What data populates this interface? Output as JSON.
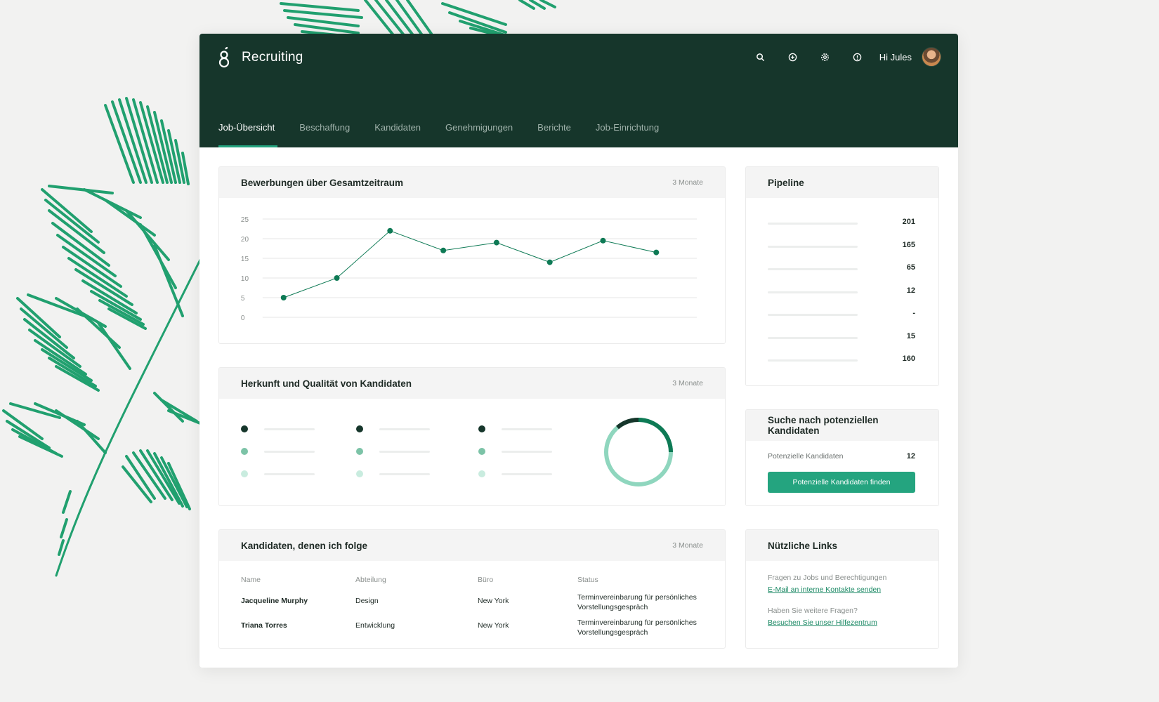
{
  "app": {
    "title": "Recruiting",
    "greeting": "Hi Jules"
  },
  "icons": {
    "search": "search-icon",
    "add": "plus-circle-icon",
    "settings": "gear-icon",
    "help": "help-icon"
  },
  "tabs": [
    {
      "label": "Job-Übersicht",
      "active": true
    },
    {
      "label": "Beschaffung",
      "active": false
    },
    {
      "label": "Kandidaten",
      "active": false
    },
    {
      "label": "Genehmigungen",
      "active": false
    },
    {
      "label": "Berichte",
      "active": false
    },
    {
      "label": "Job-Einrichtung",
      "active": false
    }
  ],
  "applications": {
    "title": "Bewerbungen über Gesamtzeitraum",
    "period": "3 Monate"
  },
  "chart_data": {
    "type": "line",
    "title": "Bewerbungen über Gesamtzeitraum",
    "x": [
      1,
      2,
      3,
      4,
      5,
      6,
      7,
      8
    ],
    "series": [
      {
        "values": [
          5,
          10,
          22,
          17,
          19,
          14,
          19.5,
          16.5
        ]
      }
    ],
    "ylim": [
      0,
      25
    ],
    "yticks": [
      "25",
      "20",
      "15",
      "10",
      "5",
      "0"
    ],
    "grid": true,
    "color": "#0e7a55"
  },
  "pipeline": {
    "title": "Pipeline",
    "values": [
      "201",
      "165",
      "65",
      "12",
      "-",
      "15",
      "160"
    ]
  },
  "source_quality": {
    "title": "Herkunft und Qualität von Kandidaten",
    "period": "3 Monate",
    "colors": [
      "#16362b",
      "#7cc3a7",
      "#c9ecdf"
    ],
    "donut_colors": {
      "primary": "#0e7a55",
      "secondary": "#8fd6be",
      "dark": "#16362b"
    }
  },
  "prospects": {
    "title": "Suche nach potenziellen Kandidaten",
    "label": "Potenzielle Kandidaten",
    "count": "12",
    "button": "Potenzielle Kandidaten finden"
  },
  "followed": {
    "title": "Kandidaten, denen ich folge",
    "period": "3 Monate",
    "columns": [
      "Name",
      "Abteilung",
      "Büro",
      "Status"
    ],
    "rows": [
      {
        "name": "Jacqueline Murphy",
        "department": "Design",
        "office": "New York",
        "status_1": "Terminvereinbarung für persönliches",
        "status_2": "Vorstellungsgespräch"
      },
      {
        "name": "Triana Torres",
        "department": "Entwicklung",
        "office": "New York",
        "status_1": "Terminvereinbarung für persönliches",
        "status_2": "Vorstellungsgespräch"
      }
    ]
  },
  "links": {
    "title": "Nützliche Links",
    "question_1": "Fragen zu Jobs und Berechtigungen",
    "link_1": "E-Mail an interne Kontakte senden",
    "question_2": "Haben Sie weitere Fragen?",
    "link_2": "Besuchen Sie unser Hilfezentrum"
  },
  "theme": {
    "header": "#16362b",
    "accent": "#24a47f"
  }
}
